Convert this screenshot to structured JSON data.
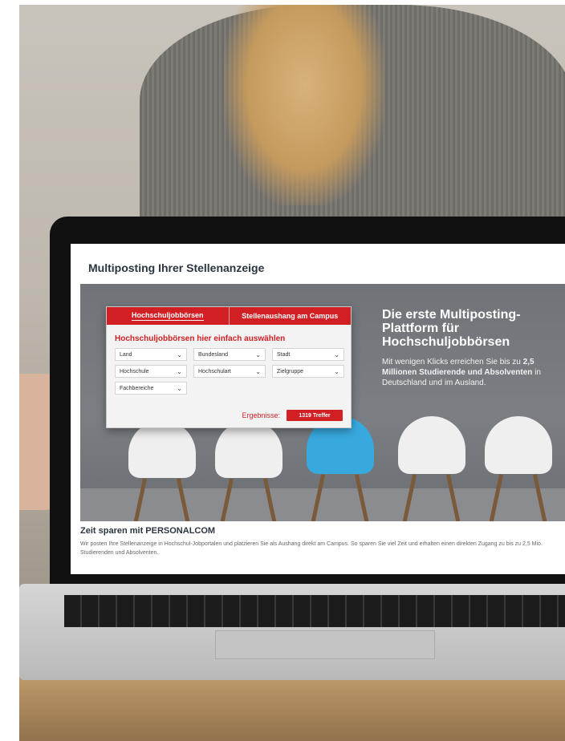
{
  "page": {
    "title": "Multiposting Ihrer Stellenanzeige"
  },
  "search": {
    "tabs": [
      "Hochschuljobbörsen",
      "Stellenaushang am Campus"
    ],
    "heading": "Hochschuljobbörsen hier einfach auswählen",
    "selects": [
      "Land",
      "Bundesland",
      "Stadt",
      "Hochschule",
      "Hochschulart",
      "Zielgruppe",
      "Fachbereiche"
    ],
    "results_label": "Ergebnisse:",
    "results_button": "1319 Treffer"
  },
  "hero": {
    "headline": "Die erste Multiposting-Plattform für Hochschuljobbörsen",
    "text_1": "Mit wenigen Klicks erreichen Sie bis zu ",
    "text_bold": "2,5 Millionen Studierende und Absolventen",
    "text_2": " in Deutschland und im Ausland."
  },
  "section": {
    "title": "Zeit sparen mit PERSONALCOM",
    "text": "Wir posten Ihre Stellenanzeige in Hochschul-Jobportalen und platzieren Sie als Aushang direkt am Campus. So sparen Sie viel Zeit und erhalten einen direkten Zugang zu bis zu 2,5 Mio. Studierenden und Absolventen."
  },
  "colors": {
    "accent": "#d11f24",
    "chair_highlight": "#38a9df"
  }
}
